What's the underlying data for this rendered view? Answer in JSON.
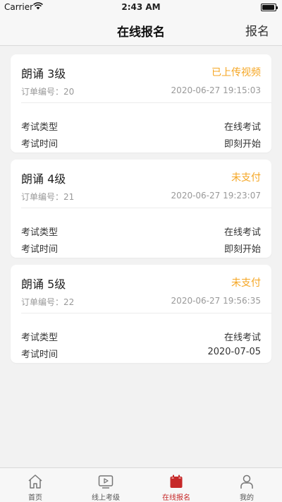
{
  "status_bar": {
    "carrier": "Carrier",
    "time": "2:43 AM"
  },
  "nav": {
    "title": "在线报名",
    "right_action": "报名"
  },
  "orders": [
    {
      "title": "朗诵 3级",
      "status": "已上传视频",
      "order_no": "订单编号：20",
      "created_at": "2020-06-27 19:15:03",
      "rows": [
        {
          "label": "考试类型",
          "value": "在线考试"
        },
        {
          "label": "考试时间",
          "value": "即刻开始"
        }
      ]
    },
    {
      "title": "朗诵 4级",
      "status": "未支付",
      "order_no": "订单编号：21",
      "created_at": "2020-06-27 19:23:07",
      "rows": [
        {
          "label": "考试类型",
          "value": "在线考试"
        },
        {
          "label": "考试时间",
          "value": "即刻开始"
        }
      ]
    },
    {
      "title": "朗诵 5级",
      "status": "未支付",
      "order_no": "订单编号：22",
      "created_at": "2020-06-27 19:56:35",
      "rows": [
        {
          "label": "考试类型",
          "value": "在线考试"
        },
        {
          "label": "考试时间",
          "value": "2020-07-05"
        }
      ]
    }
  ],
  "tabs": [
    {
      "label": "首页",
      "icon": "home-icon"
    },
    {
      "label": "线上考级",
      "icon": "video-icon"
    },
    {
      "label": "在线报名",
      "icon": "registration-icon",
      "active": true
    },
    {
      "label": "我的",
      "icon": "profile-icon"
    }
  ],
  "colors": {
    "status_accent": "#f5a623",
    "tab_active": "#c62828",
    "background": "#f2f2f2"
  }
}
